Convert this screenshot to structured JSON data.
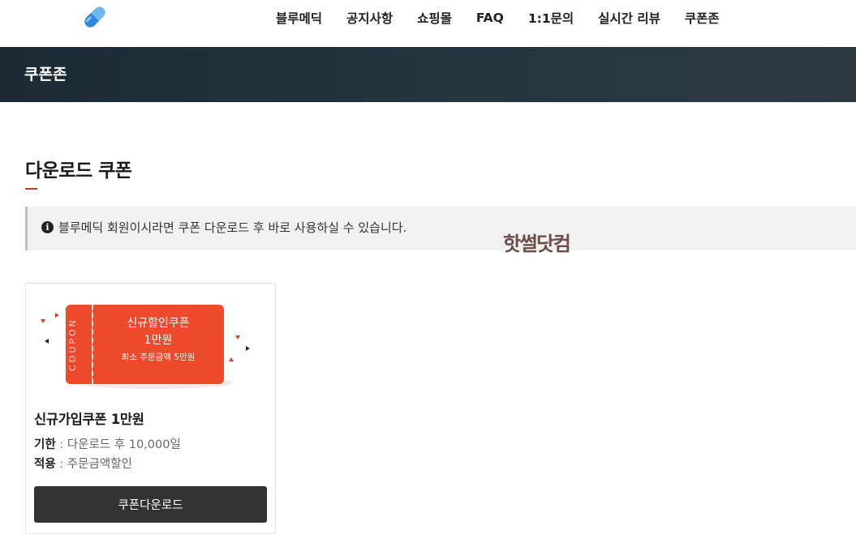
{
  "header": {
    "logo_icon": "capsule-pill-icon",
    "nav": [
      {
        "label": "블루메딕"
      },
      {
        "label": "공지사항"
      },
      {
        "label": "쇼핑몰"
      },
      {
        "label": "FAQ"
      },
      {
        "label": "1:1문의"
      },
      {
        "label": "실시간 리뷰"
      },
      {
        "label": "쿠폰존"
      }
    ]
  },
  "band": {
    "title": "쿠폰존"
  },
  "section": {
    "title": "다운로드 쿠폰",
    "notice_icon": "info-circle-icon",
    "notice": "블루메딕 회원이시라면 쿠폰 다운로드 후 바로 사용하실 수 있습니다."
  },
  "watermark": "핫썰닷컴",
  "coupons": [
    {
      "art": {
        "stub_label": "COUPON",
        "title": "신규할인쿠폰",
        "amount": "1만원",
        "min_order": "최소 주문금액 5만원"
      },
      "name": "신규가입쿠폰 1만원",
      "period_label": "기한",
      "period_value": "다운로드 후 10,000일",
      "apply_label": "적용",
      "apply_value": "주문금액할인",
      "separator": ":",
      "button": "쿠폰다운로드"
    }
  ],
  "colors": {
    "coupon_red": "#f04a2c",
    "band_dark": "#1b2a33",
    "accent_underline": "#c0392b",
    "button_dark": "#333333"
  }
}
